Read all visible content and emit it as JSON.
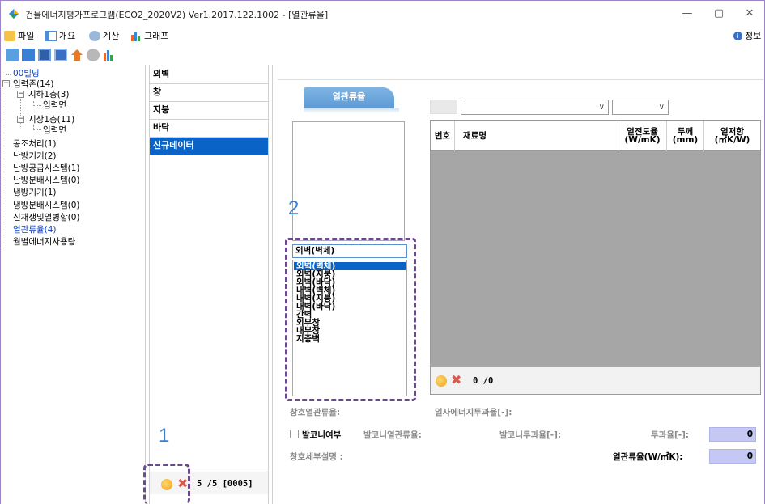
{
  "window": {
    "title": "건물에너지평가프로그램(ECO2_2020V2) Ver1.2017.122.1002 - [열관류율]",
    "minimize": "—",
    "maximize": "▢",
    "close": "✕"
  },
  "menu": {
    "file": "파일",
    "overview": "개요",
    "calc": "계산",
    "graph": "그래프",
    "info": "정보"
  },
  "tree": {
    "building": "00빌딩",
    "input_zone": "입력존(14)",
    "basement1": "지하1층(3)",
    "basement1_child": "입력면",
    "floor1": "지상1층(11)",
    "floor1_child": "입력면",
    "ahu": "공조처리(1)",
    "heating_equip": "난방기기(2)",
    "heating_supply": "난방공급시스템(1)",
    "heating_dist": "난방분배시스템(0)",
    "cooling_equip": "냉방기기(1)",
    "cooling_dist": "냉방분배시스템(0)",
    "renewable": "신재생및열병합(0)",
    "uvalue": "열관류율(4)",
    "monthly": "월별에너지사용량"
  },
  "categories": [
    "외벽",
    "창",
    "지붕",
    "바닥",
    "신규데이터"
  ],
  "category_footer": "5 /5 [0005]",
  "tab_label": "열관류율",
  "material_input": "외벽(벽체)",
  "material_options": [
    "외벽(벽체)",
    "외벽(지붕)",
    "외벽(바닥)",
    "내벽(벽체)",
    "내벽(지붕)",
    "내벽(바닥)",
    "간벽",
    "외부창",
    "내부창",
    "지중벽"
  ],
  "grid": {
    "col_no": "번호",
    "col_name": "재료명",
    "col_conductivity": "열전도율\n(W/mK)",
    "col_thickness": "두께\n(mm)",
    "col_resistance": "열저항\n(㎡K/W)",
    "footer": "0 /0"
  },
  "labels": {
    "window_uvalue": "창호열관류율:",
    "shgc": "일사에너지투과율[-]:",
    "balcony": "발코니여부",
    "balcony_uvalue": "발코니열관류율:",
    "balcony_trans": "발코니투과율[-]:",
    "transmittance": "투과율[-]:",
    "transmittance_value": "0",
    "window_desc": "창호세부설명 :",
    "uvalue_label": "열관류율(W/㎡K):",
    "uvalue_value": "0"
  },
  "callouts": {
    "one": "1",
    "two": "2"
  },
  "colors": {
    "selection": "#0a64c8",
    "callout": "#6a4a8c",
    "callout_number": "#3b7fd3",
    "value_box": "#c6c8f4"
  }
}
